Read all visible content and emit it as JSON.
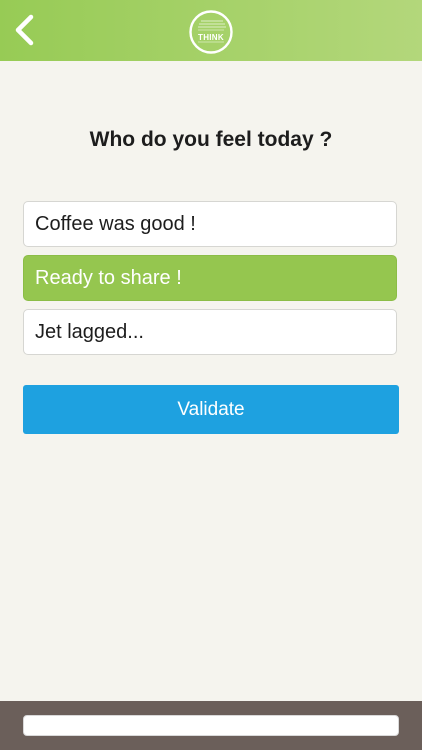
{
  "header": {
    "back_icon": "chevron-left-icon",
    "logo_text": "THINK",
    "background_start": "#97cb55",
    "background_end": "#b3d77b"
  },
  "question": "Who do you feel today ?",
  "options": [
    {
      "label": "Coffee was good !",
      "selected": false
    },
    {
      "label": "Ready to share !",
      "selected": true
    },
    {
      "label": "Jet lagged...",
      "selected": false
    }
  ],
  "validate_label": "Validate",
  "colors": {
    "selected_option": "#95c64f",
    "validate_button": "#1ea1e0",
    "footer": "#6b5f5a",
    "page_background": "#f5f4ee"
  },
  "footer": {
    "input_value": "",
    "input_placeholder": ""
  }
}
